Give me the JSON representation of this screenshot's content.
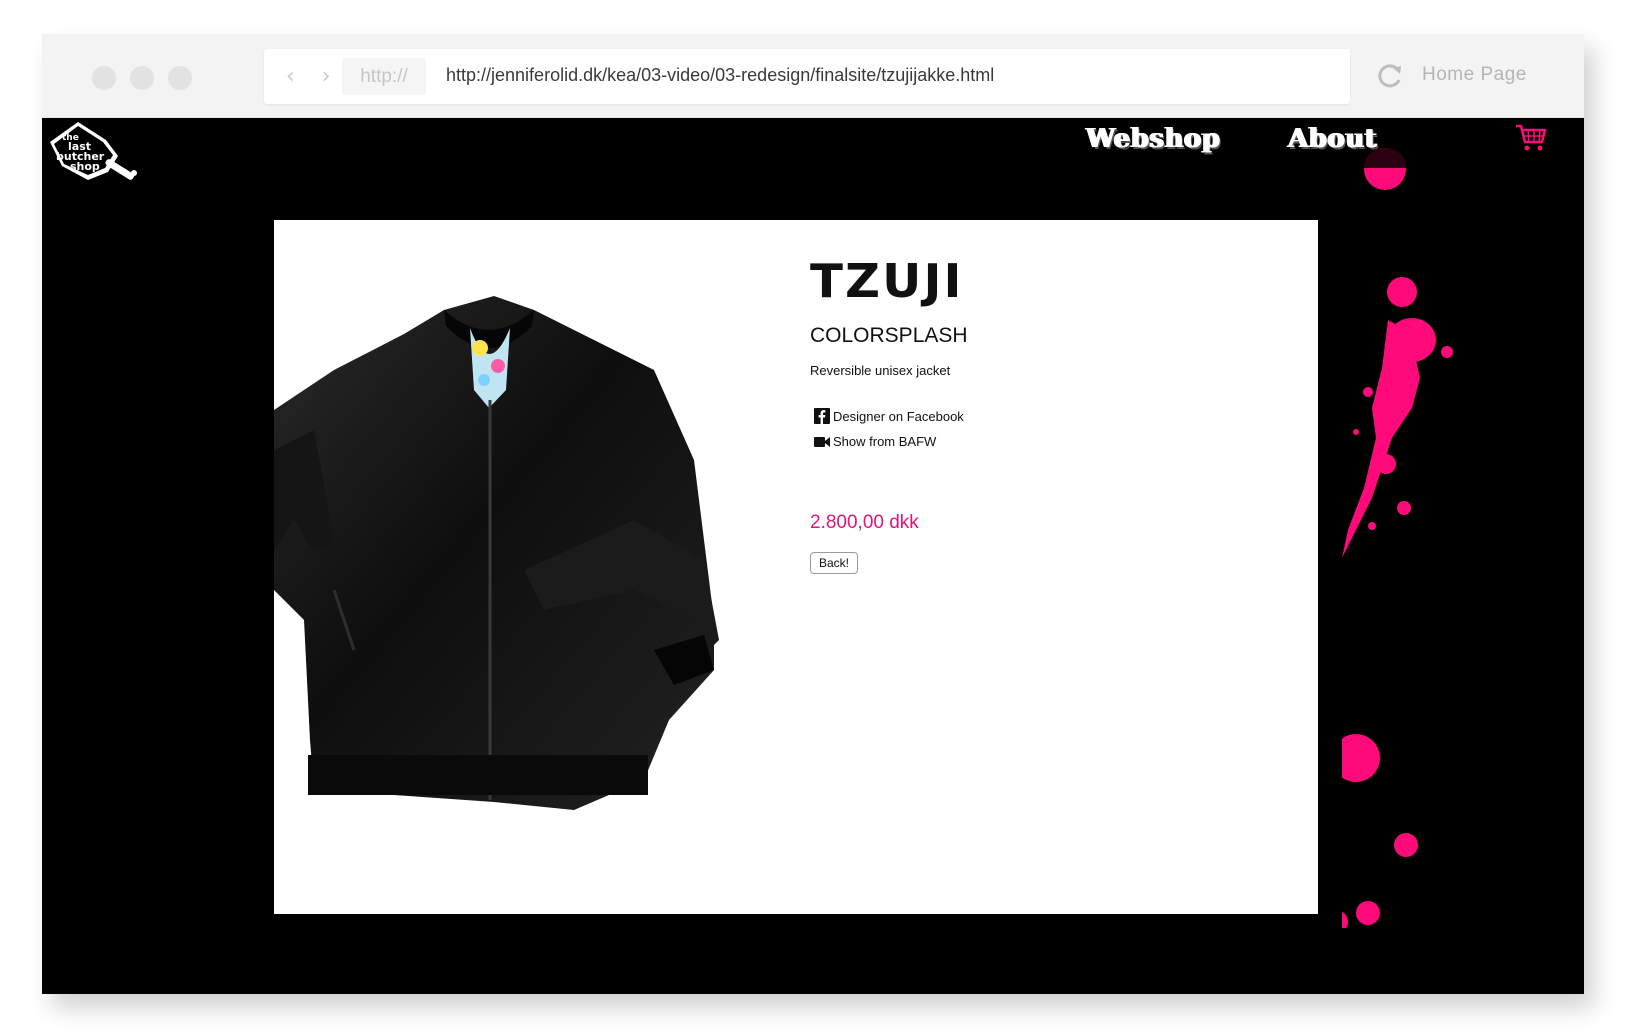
{
  "browser": {
    "protocol": "http://",
    "url": "http://jenniferolid.dk/kea/03-video/03-redesign/finalsite/tzujijakke.html",
    "home_label": "Home Page",
    "nav_arrows": "‹ ›",
    "icons": {
      "reload": "reload-icon",
      "back": "chevron-left-icon",
      "forward": "chevron-right-icon"
    }
  },
  "site": {
    "logo_text": [
      "the",
      "last",
      "butcher",
      "shop"
    ],
    "nav": [
      {
        "label": "Webshop"
      },
      {
        "label": "About"
      }
    ],
    "cart_icon": "shopping-cart-icon",
    "accent_color": "#ff0a7a"
  },
  "product": {
    "brand": "TZUJI",
    "collection": "COLORSPLASH",
    "description": "Reversible unisex jacket",
    "links": [
      {
        "icon": "facebook-icon",
        "label": "Designer on Facebook"
      },
      {
        "icon": "video-camera-icon",
        "label": "Show from BAFW"
      }
    ],
    "price": "2.800,00 dkk",
    "price_color": "#e2157b",
    "back_label": "Back!"
  }
}
